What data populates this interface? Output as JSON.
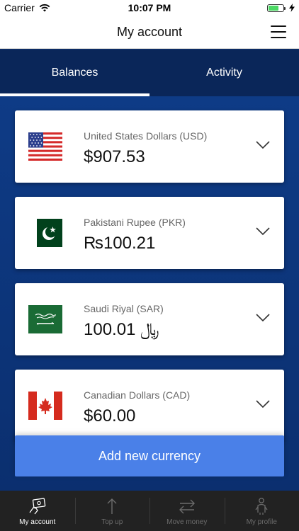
{
  "status": {
    "carrier": "Carrier",
    "time": "10:07 PM"
  },
  "header": {
    "title": "My account"
  },
  "tabs": [
    {
      "label": "Balances"
    },
    {
      "label": "Activity"
    }
  ],
  "balances": [
    {
      "name": "United States Dollars (USD)",
      "amount": "$907.53",
      "flag": "us-flag"
    },
    {
      "name": "Pakistani Rupee (PKR)",
      "amount": "₨100.21",
      "flag": "pk-flag"
    },
    {
      "name": "Saudi Riyal (SAR)",
      "amount": "100.01 ﷼",
      "flag": "sa-flag"
    },
    {
      "name": "Canadian Dollars (CAD)",
      "amount": "$60.00",
      "flag": "ca-flag"
    }
  ],
  "actions": {
    "add_currency": "Add new currency"
  },
  "tabbar": [
    {
      "label": "My account",
      "icon": "wallet-icon"
    },
    {
      "label": "Top up",
      "icon": "arrow-up-icon"
    },
    {
      "label": "Move money",
      "icon": "transfer-icon"
    },
    {
      "label": "My profile",
      "icon": "person-icon"
    }
  ],
  "colors": {
    "primary_bg": "#0c2f6c",
    "button": "#4a80e8",
    "tabbar": "#222222"
  }
}
